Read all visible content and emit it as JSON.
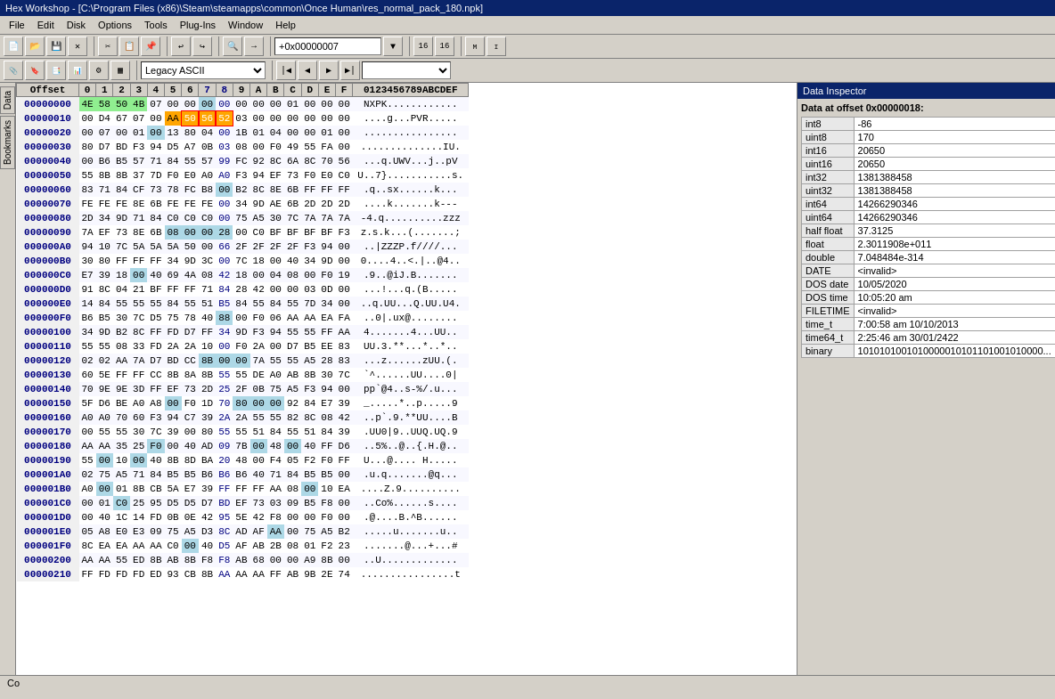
{
  "title": "Hex Workshop - [C:\\Program Files (x86)\\Steam\\steamapps\\common\\Once Human\\res_normal_pack_180.npk]",
  "menu": [
    "File",
    "Edit",
    "Disk",
    "Disk",
    "Options",
    "Tools",
    "Plug-Ins",
    "Window",
    "Help"
  ],
  "toolbar": {
    "offset_label": "+0x00000007",
    "encoding": "Legacy ASCII"
  },
  "hex_header": {
    "addr": "Offset",
    "cols": [
      "0",
      "1",
      "2",
      "3",
      "4",
      "5",
      "6",
      "7",
      "8",
      "9",
      "A",
      "B",
      "C",
      "D",
      "E",
      "F"
    ],
    "ascii_header": "0123456789ABCDEF"
  },
  "hex_rows": [
    {
      "addr": "00000000",
      "bytes": [
        "4E",
        "58",
        "50",
        "4B",
        "07",
        "00",
        "00",
        "00",
        "00",
        "00",
        "00",
        "00",
        "01",
        "00",
        "00",
        "00"
      ],
      "ascii": "NXPK............",
      "highlights": {
        "3": "green",
        "0": "green",
        "1": "green",
        "2": "green"
      }
    },
    {
      "addr": "00000010",
      "bytes": [
        "00",
        "D4",
        "67",
        "07",
        "00",
        "AA",
        "50",
        "56",
        "52",
        "03",
        "00",
        "00",
        "00",
        "00",
        "00",
        "00"
      ],
      "ascii": "....g...PVR.....",
      "highlights": {
        "5": "blue",
        "6": "blue",
        "7": "blue",
        "8": "blue"
      }
    },
    {
      "addr": "00000020",
      "bytes": [
        "00",
        "07",
        "00",
        "01",
        "00",
        "13",
        "80",
        "04",
        "00",
        "1B",
        "01",
        "04",
        "00",
        "00",
        "01",
        "00"
      ],
      "ascii": "................",
      "highlights": {}
    },
    {
      "addr": "00000030",
      "bytes": [
        "80",
        "D7",
        "BD",
        "F3",
        "94",
        "D5",
        "A7",
        "0B",
        "03",
        "08",
        "00",
        "F0",
        "49",
        "55",
        "FA",
        "00"
      ],
      "ascii": "..............IU.",
      "highlights": {}
    },
    {
      "addr": "00000040",
      "bytes": [
        "00",
        "B6",
        "B5",
        "57",
        "71",
        "84",
        "55",
        "57",
        "99",
        "FC",
        "92",
        "8C",
        "6A",
        "8C",
        "70",
        "56"
      ],
      "ascii": "...q.UWV...j..pV",
      "highlights": {}
    },
    {
      "addr": "00000050",
      "bytes": [
        "55",
        "8B",
        "8B",
        "37",
        "7D",
        "F0",
        "E0",
        "A0",
        "A0",
        "F3",
        "94",
        "EF",
        "73",
        "F0",
        "E0",
        "C0"
      ],
      "ascii": "U..7}...........s.",
      "highlights": {}
    },
    {
      "addr": "00000060",
      "bytes": [
        "83",
        "71",
        "84",
        "CF",
        "73",
        "78",
        "FC",
        "B8",
        "00",
        "B2",
        "8C",
        "8E",
        "6B",
        "FF",
        "FF",
        "FF"
      ],
      "ascii": ".q..sx......k...",
      "highlights": {
        "8": "blue"
      }
    },
    {
      "addr": "00000070",
      "bytes": [
        "FE",
        "FE",
        "FE",
        "8E",
        "6B",
        "FE",
        "FE",
        "FE",
        "00",
        "34",
        "9D",
        "AE",
        "6B",
        "2D",
        "2D",
        "2D"
      ],
      "ascii": "....k.......k---",
      "highlights": {}
    },
    {
      "addr": "00000080",
      "bytes": [
        "2D",
        "34",
        "9D",
        "71",
        "84",
        "C0",
        "C0",
        "C0",
        "00",
        "75",
        "A5",
        "30",
        "7C",
        "7A",
        "7A",
        "7A"
      ],
      "ascii": "-4.q..........zzz",
      "highlights": {}
    },
    {
      "addr": "00000090",
      "bytes": [
        "7A",
        "EF",
        "73",
        "8E",
        "6B",
        "08",
        "00",
        "00",
        "28",
        "00",
        "C0",
        "BF",
        "BF",
        "BF",
        "BF",
        "F3"
      ],
      "ascii": "z.s.k...(.......;",
      "highlights": {
        "5": "blue",
        "6": "blue",
        "7": "blue",
        "8": "blue"
      }
    },
    {
      "addr": "000000A0",
      "bytes": [
        "94",
        "10",
        "7C",
        "5A",
        "5A",
        "5A",
        "50",
        "00",
        "66",
        "2F",
        "2F",
        "2F",
        "2F",
        "F3",
        "94",
        "00"
      ],
      "ascii": "..|ZZZP.f////...",
      "highlights": {}
    },
    {
      "addr": "000000B0",
      "bytes": [
        "30",
        "80",
        "FF",
        "FF",
        "FF",
        "34",
        "9D",
        "3C",
        "00",
        "7C",
        "18",
        "00",
        "40",
        "34",
        "9D",
        "00"
      ],
      "ascii": "0....4..<.|..@4..",
      "highlights": {}
    },
    {
      "addr": "000000C0",
      "bytes": [
        "E7",
        "39",
        "18",
        "00",
        "40",
        "69",
        "4A",
        "08",
        "42",
        "18",
        "00",
        "04",
        "08",
        "00",
        "F0",
        "19"
      ],
      "ascii": ".9..@iJ.B.......",
      "highlights": {
        "3": "blue"
      }
    },
    {
      "addr": "000000D0",
      "bytes": [
        "91",
        "8C",
        "04",
        "21",
        "BF",
        "FF",
        "FF",
        "71",
        "84",
        "28",
        "42",
        "00",
        "00",
        "03",
        "0D",
        "00"
      ],
      "ascii": "...!...q.(B.....",
      "highlights": {}
    },
    {
      "addr": "000000E0",
      "bytes": [
        "14",
        "84",
        "55",
        "55",
        "55",
        "84",
        "55",
        "51",
        "B5",
        "84",
        "55",
        "84",
        "55",
        "7D",
        "34",
        "00"
      ],
      "ascii": "..q.UU...Q.UU.U4.",
      "highlights": {}
    },
    {
      "addr": "000000F0",
      "bytes": [
        "B6",
        "B5",
        "30",
        "7C",
        "D5",
        "75",
        "78",
        "40",
        "88",
        "00",
        "F0",
        "06",
        "AA",
        "AA",
        "EA",
        "FA"
      ],
      "ascii": "..0|.ux@........",
      "highlights": {
        "8": "blue"
      }
    },
    {
      "addr": "00000100",
      "bytes": [
        "34",
        "9D",
        "B2",
        "8C",
        "FF",
        "FD",
        "D7",
        "FF",
        "34",
        "9D",
        "F3",
        "94",
        "55",
        "55",
        "FF",
        "AA"
      ],
      "ascii": "4.......4...UU..",
      "highlights": {}
    },
    {
      "addr": "00000110",
      "bytes": [
        "55",
        "55",
        "08",
        "33",
        "FD",
        "2A",
        "2A",
        "10",
        "00",
        "F0",
        "2A",
        "00",
        "D7",
        "B5",
        "EE",
        "83"
      ],
      "ascii": "UU.3.**...*..*..",
      "highlights": {}
    },
    {
      "addr": "00000120",
      "bytes": [
        "02",
        "02",
        "AA",
        "7A",
        "D7",
        "BD",
        "CC",
        "8B",
        "00",
        "00",
        "7A",
        "55",
        "55",
        "A5",
        "28",
        "83"
      ],
      "ascii": "...z......zUU.(.",
      "highlights": {
        "7": "blue",
        "8": "blue",
        "9": "blue"
      }
    },
    {
      "addr": "00000130",
      "bytes": [
        "60",
        "5E",
        "FF",
        "FF",
        "CC",
        "8B",
        "8A",
        "8B",
        "55",
        "55",
        "DE",
        "A0",
        "AB",
        "8B",
        "30",
        "7C"
      ],
      "ascii": "`^......UU....0|",
      "highlights": {}
    },
    {
      "addr": "00000140",
      "bytes": [
        "70",
        "9E",
        "9E",
        "3D",
        "FF",
        "EF",
        "73",
        "2D",
        "25",
        "2F",
        "0B",
        "75",
        "A5",
        "F3",
        "94",
        "00"
      ],
      "ascii": "pp`@4..s-%/.u...",
      "highlights": {}
    },
    {
      "addr": "00000150",
      "bytes": [
        "5F",
        "D6",
        "BE",
        "A0",
        "A8",
        "00",
        "F0",
        "1D",
        "70",
        "80",
        "00",
        "00",
        "92",
        "84",
        "E7",
        "39"
      ],
      "ascii": "_.....*..p.....9",
      "highlights": {
        "5": "blue",
        "9": "blue",
        "10": "blue",
        "11": "blue"
      }
    },
    {
      "addr": "00000160",
      "bytes": [
        "A0",
        "A0",
        "70",
        "60",
        "F3",
        "94",
        "C7",
        "39",
        "2A",
        "2A",
        "55",
        "55",
        "82",
        "8C",
        "08",
        "42"
      ],
      "ascii": "..p`.9.**UU....B",
      "highlights": {}
    },
    {
      "addr": "00000170",
      "bytes": [
        "00",
        "55",
        "55",
        "30",
        "7C",
        "39",
        "00",
        "80",
        "55",
        "55",
        "51",
        "84",
        "55",
        "51",
        "84",
        "39"
      ],
      "ascii": ".UU0|9..UUQ.UQ.9",
      "highlights": {}
    },
    {
      "addr": "00000180",
      "bytes": [
        "AA",
        "AA",
        "35",
        "25",
        "F0",
        "00",
        "40",
        "AD",
        "09",
        "7B",
        "00",
        "48",
        "00",
        "40",
        "FF",
        "D6"
      ],
      "ascii": "..5%..@..{.H.@..",
      "highlights": {
        "4": "blue",
        "10": "blue",
        "12": "blue"
      }
    },
    {
      "addr": "00000190",
      "bytes": [
        "55",
        "00",
        "10",
        "00",
        "40",
        "8B",
        "8D",
        "BA",
        "20",
        "48",
        "00",
        "F4",
        "05",
        "F2",
        "F0",
        "FF"
      ],
      "ascii": "U...@.... H.....",
      "highlights": {
        "1": "blue",
        "3": "blue"
      }
    },
    {
      "addr": "000001A0",
      "bytes": [
        "02",
        "75",
        "A5",
        "71",
        "84",
        "B5",
        "B5",
        "B6",
        "B6",
        "B6",
        "40",
        "71",
        "84",
        "B5",
        "B5",
        "00"
      ],
      "ascii": ".u.q.......@q...",
      "highlights": {}
    },
    {
      "addr": "000001B0",
      "bytes": [
        "A0",
        "00",
        "01",
        "8B",
        "CB",
        "5A",
        "E7",
        "39",
        "FF",
        "FF",
        "FF",
        "AA",
        "08",
        "00",
        "10",
        "EA"
      ],
      "ascii": "....Z.9..........",
      "highlights": {
        "1": "blue",
        "13": "blue"
      }
    },
    {
      "addr": "000001C0",
      "bytes": [
        "00",
        "01",
        "C0",
        "25",
        "95",
        "D5",
        "D5",
        "D7",
        "BD",
        "EF",
        "73",
        "03",
        "09",
        "B5",
        "F8",
        "00"
      ],
      "ascii": "..Co%......s....",
      "highlights": {
        "2": "blue"
      }
    },
    {
      "addr": "000001D0",
      "bytes": [
        "00",
        "40",
        "1C",
        "14",
        "FD",
        "0B",
        "0E",
        "42",
        "95",
        "5E",
        "42",
        "F8",
        "00",
        "00",
        "F0",
        "00"
      ],
      "ascii": ".@....B.^B......",
      "highlights": {}
    },
    {
      "addr": "000001E0",
      "bytes": [
        "05",
        "A8",
        "E0",
        "E3",
        "09",
        "75",
        "A5",
        "D3",
        "8C",
        "AD",
        "AF",
        "AA",
        "00",
        "75",
        "A5",
        "B2"
      ],
      "ascii": ".....u.......u..",
      "highlights": {
        "11": "blue"
      }
    },
    {
      "addr": "000001F0",
      "bytes": [
        "8C",
        "EA",
        "EA",
        "AA",
        "AA",
        "C0",
        "00",
        "40",
        "D5",
        "AF",
        "AB",
        "2B",
        "08",
        "01",
        "F2",
        "23"
      ],
      "ascii": ".......@...+...#",
      "highlights": {
        "6": "blue"
      }
    },
    {
      "addr": "00000200",
      "bytes": [
        "AA",
        "AA",
        "55",
        "ED",
        "8B",
        "AB",
        "8B",
        "F8",
        "F8",
        "AB",
        "68",
        "00",
        "00",
        "A9",
        "8B",
        "00"
      ],
      "ascii": "..U.............",
      "highlights": {}
    },
    {
      "addr": "00000210",
      "bytes": [
        "FF",
        "FD",
        "FD",
        "FD",
        "ED",
        "93",
        "CB",
        "8B",
        "AA",
        "AA",
        "AA",
        "FF",
        "AB",
        "9B",
        "2E",
        "74"
      ],
      "ascii": "................t",
      "highlights": {}
    }
  ],
  "data_inspector": {
    "title": "Data Inspector",
    "offset_label": "Data at offset 0x00000018:",
    "fields": [
      {
        "name": "int8",
        "value": "-86"
      },
      {
        "name": "uint8",
        "value": "170"
      },
      {
        "name": "int16",
        "value": "20650"
      },
      {
        "name": "uint16",
        "value": "20650"
      },
      {
        "name": "int32",
        "value": "1381388458"
      },
      {
        "name": "uint32",
        "value": "1381388458"
      },
      {
        "name": "int64",
        "value": "14266290346"
      },
      {
        "name": "uint64",
        "value": "14266290346"
      },
      {
        "name": "half float",
        "value": "37.3125"
      },
      {
        "name": "float",
        "value": "2.3011908e+011"
      },
      {
        "name": "double",
        "value": "7.048484e-314"
      },
      {
        "name": "DATE",
        "value": "<invalid>"
      },
      {
        "name": "DOS date",
        "value": "10/05/2020"
      },
      {
        "name": "DOS time",
        "value": "10:05:20 am"
      },
      {
        "name": "FILETIME",
        "value": "<invalid>"
      },
      {
        "name": "time_t",
        "value": "7:00:58 am 10/10/2013"
      },
      {
        "name": "time64_t",
        "value": "2:25:46 am 30/01/2422"
      },
      {
        "name": "binary",
        "value": "1010101001010000010101101001010000..."
      }
    ]
  },
  "status_bar": {
    "co_label": "Co"
  }
}
